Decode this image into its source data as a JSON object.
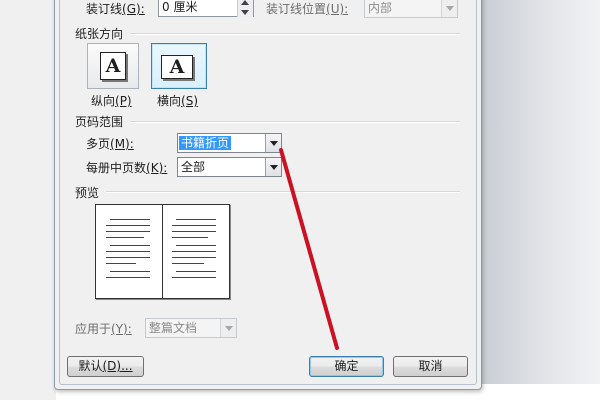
{
  "top_row": {
    "gutter_label": "装订线",
    "gutter_key": "(G):",
    "gutter_value": "0 厘米",
    "gutter_pos_label": "装订线位置",
    "gutter_pos_key": "(U):",
    "gutter_pos_value": "内部"
  },
  "orientation": {
    "title": "纸张方向",
    "portrait_label": "纵向",
    "portrait_key": "(P)",
    "landscape_label": "横向",
    "landscape_key": "(S)",
    "icon_glyph": "A",
    "selected": "landscape"
  },
  "pages": {
    "title": "页码范围",
    "multiple_label": "多页",
    "multiple_key": "(M):",
    "multiple_value": "书籍折页",
    "sheets_label": "每册中页数",
    "sheets_key": "(K):",
    "sheets_value": "全部"
  },
  "preview": {
    "title": "预览",
    "apply_label": "应用于",
    "apply_key": "(Y):",
    "apply_value": "整篇文档"
  },
  "buttons": {
    "default_label": "默认",
    "default_key": "(D)...",
    "ok_label": "确定",
    "cancel_label": "取消"
  },
  "colors": {
    "annotation_line": "#cc1122",
    "selection": "#3399ff",
    "dialog_bg": "#f0f0f0"
  }
}
